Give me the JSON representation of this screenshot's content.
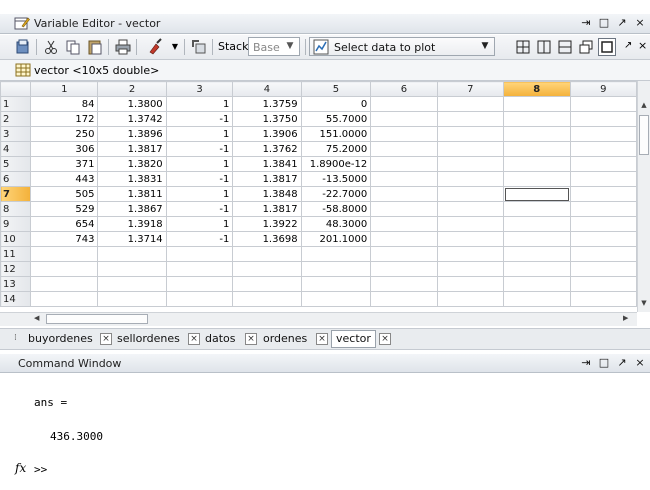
{
  "variable_editor": {
    "title": "Variable Editor - vector",
    "window_controls": [
      "⇥",
      "□",
      "↗",
      "×"
    ],
    "toolbar": {
      "stack_label": "Stack:",
      "stack_value": "Base",
      "plot_selector": "Select data to plot"
    },
    "variable_info": "vector <10x5 double>",
    "columns": [
      "1",
      "2",
      "3",
      "4",
      "5",
      "6",
      "7",
      "8",
      "9"
    ],
    "selected_column": "8",
    "selected_row": "7",
    "rows": [
      {
        "row": "1",
        "cells": [
          "84",
          "1.3800",
          "1",
          "1.3759",
          "0",
          "",
          "",
          "",
          ""
        ]
      },
      {
        "row": "2",
        "cells": [
          "172",
          "1.3742",
          "-1",
          "1.3750",
          "55.7000",
          "",
          "",
          "",
          ""
        ]
      },
      {
        "row": "3",
        "cells": [
          "250",
          "1.3896",
          "1",
          "1.3906",
          "151.0000",
          "",
          "",
          "",
          ""
        ]
      },
      {
        "row": "4",
        "cells": [
          "306",
          "1.3817",
          "-1",
          "1.3762",
          "75.2000",
          "",
          "",
          "",
          ""
        ]
      },
      {
        "row": "5",
        "cells": [
          "371",
          "1.3820",
          "1",
          "1.3841",
          "1.8900e-12",
          "",
          "",
          "",
          ""
        ]
      },
      {
        "row": "6",
        "cells": [
          "443",
          "1.3831",
          "-1",
          "1.3817",
          "-13.5000",
          "",
          "",
          "",
          ""
        ]
      },
      {
        "row": "7",
        "cells": [
          "505",
          "1.3811",
          "1",
          "1.3848",
          "-22.7000",
          "",
          "",
          "",
          ""
        ]
      },
      {
        "row": "8",
        "cells": [
          "529",
          "1.3867",
          "-1",
          "1.3817",
          "-58.8000",
          "",
          "",
          "",
          ""
        ]
      },
      {
        "row": "9",
        "cells": [
          "654",
          "1.3918",
          "1",
          "1.3922",
          "48.3000",
          "",
          "",
          "",
          ""
        ]
      },
      {
        "row": "10",
        "cells": [
          "743",
          "1.3714",
          "-1",
          "1.3698",
          "201.1000",
          "",
          "",
          "",
          ""
        ]
      },
      {
        "row": "11",
        "cells": [
          "",
          "",
          "",
          "",
          "",
          "",
          "",
          "",
          ""
        ]
      },
      {
        "row": "12",
        "cells": [
          "",
          "",
          "",
          "",
          "",
          "",
          "",
          "",
          ""
        ]
      },
      {
        "row": "13",
        "cells": [
          "",
          "",
          "",
          "",
          "",
          "",
          "",
          "",
          ""
        ]
      },
      {
        "row": "14",
        "cells": [
          "",
          "",
          "",
          "",
          "",
          "",
          "",
          "",
          ""
        ]
      }
    ],
    "tabs": [
      {
        "label": "buyordenes",
        "active": false
      },
      {
        "label": "sellordenes",
        "active": false
      },
      {
        "label": "datos",
        "active": false
      },
      {
        "label": "ordenes",
        "active": false
      },
      {
        "label": "vector",
        "active": true
      }
    ]
  },
  "command_window": {
    "title": "Command Window",
    "window_controls": [
      "⇥",
      "□",
      "↗",
      "×"
    ],
    "output_lines": [
      "ans =",
      "436.3000"
    ],
    "prompt": ">>",
    "fx_label": "fx"
  },
  "colors": {
    "selected_header": "#f3b13a",
    "grid_line": "#c8ccd2",
    "titlebar": "#dfe4ea"
  }
}
